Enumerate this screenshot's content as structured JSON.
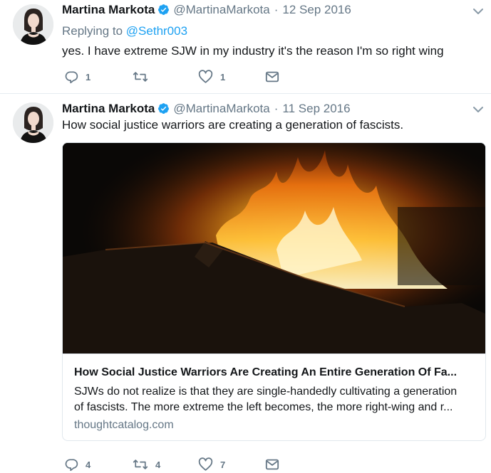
{
  "tweets": [
    {
      "author_name": "Martina Markota",
      "handle": "@MartinaMarkota",
      "separator": "·",
      "date": "12 Sep 2016",
      "replying_label": "Replying to",
      "replying_to": "@Sethr003",
      "text": "yes. I have extreme SJW in my industry it's the reason I'm so right wing",
      "reply_count": "1",
      "retweet_count": "",
      "like_count": "1"
    },
    {
      "author_name": "Martina Markota",
      "handle": "@MartinaMarkota",
      "separator": "·",
      "date": "11 Sep 2016",
      "text": "How social justice warriors are creating a generation of fascists.",
      "card": {
        "title": "How Social Justice Warriors Are Creating An Entire Generation Of Fa...",
        "desc_line1": "SJWs do not realize is that they are single-handedly cultivating a generation",
        "desc_line2": "of fascists. The more extreme the left becomes, the more right-wing and r...",
        "domain": "thoughtcatalog.com"
      },
      "reply_count": "4",
      "retweet_count": "4",
      "like_count": "7"
    }
  ],
  "icons": [
    "verified-badge-icon",
    "caret-down-icon",
    "reply-icon",
    "retweet-icon",
    "like-icon",
    "direct-message-icon"
  ],
  "colors": {
    "accent": "#1da1f2",
    "secondary_text": "#657786",
    "primary_text": "#14171a",
    "divider": "#e6ecf0"
  }
}
